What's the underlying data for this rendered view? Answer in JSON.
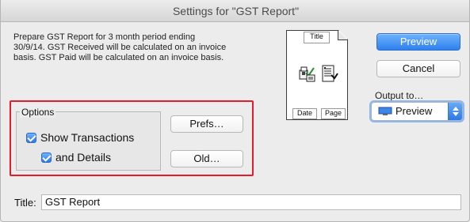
{
  "window": {
    "title": "Settings for \"GST Report\""
  },
  "description": "Prepare GST Report for 3 month period ending 30/9/14. GST Received will be calculated on an invoice basis. GST Paid will be calculated on an invoice basis.",
  "preview_layout": {
    "title": "Title",
    "date": "Date",
    "page": "Page",
    "left_icon": "document-print-icon",
    "right_icon": "check-document-icon"
  },
  "buttons": {
    "preview": "Preview",
    "cancel": "Cancel",
    "prefs": "Prefs…",
    "old": "Old…"
  },
  "output": {
    "label": "Output to…",
    "selected": "Preview",
    "icon": "monitor-icon"
  },
  "options": {
    "legend": "Options",
    "show_transactions": "Show Transactions",
    "and_details": "and Details"
  },
  "title_field": {
    "label": "Title:",
    "value": "GST Report"
  },
  "colors": {
    "primary_button": "#2f80ee",
    "highlight": "#e61b2b",
    "checkbox": "#2d78e5"
  }
}
